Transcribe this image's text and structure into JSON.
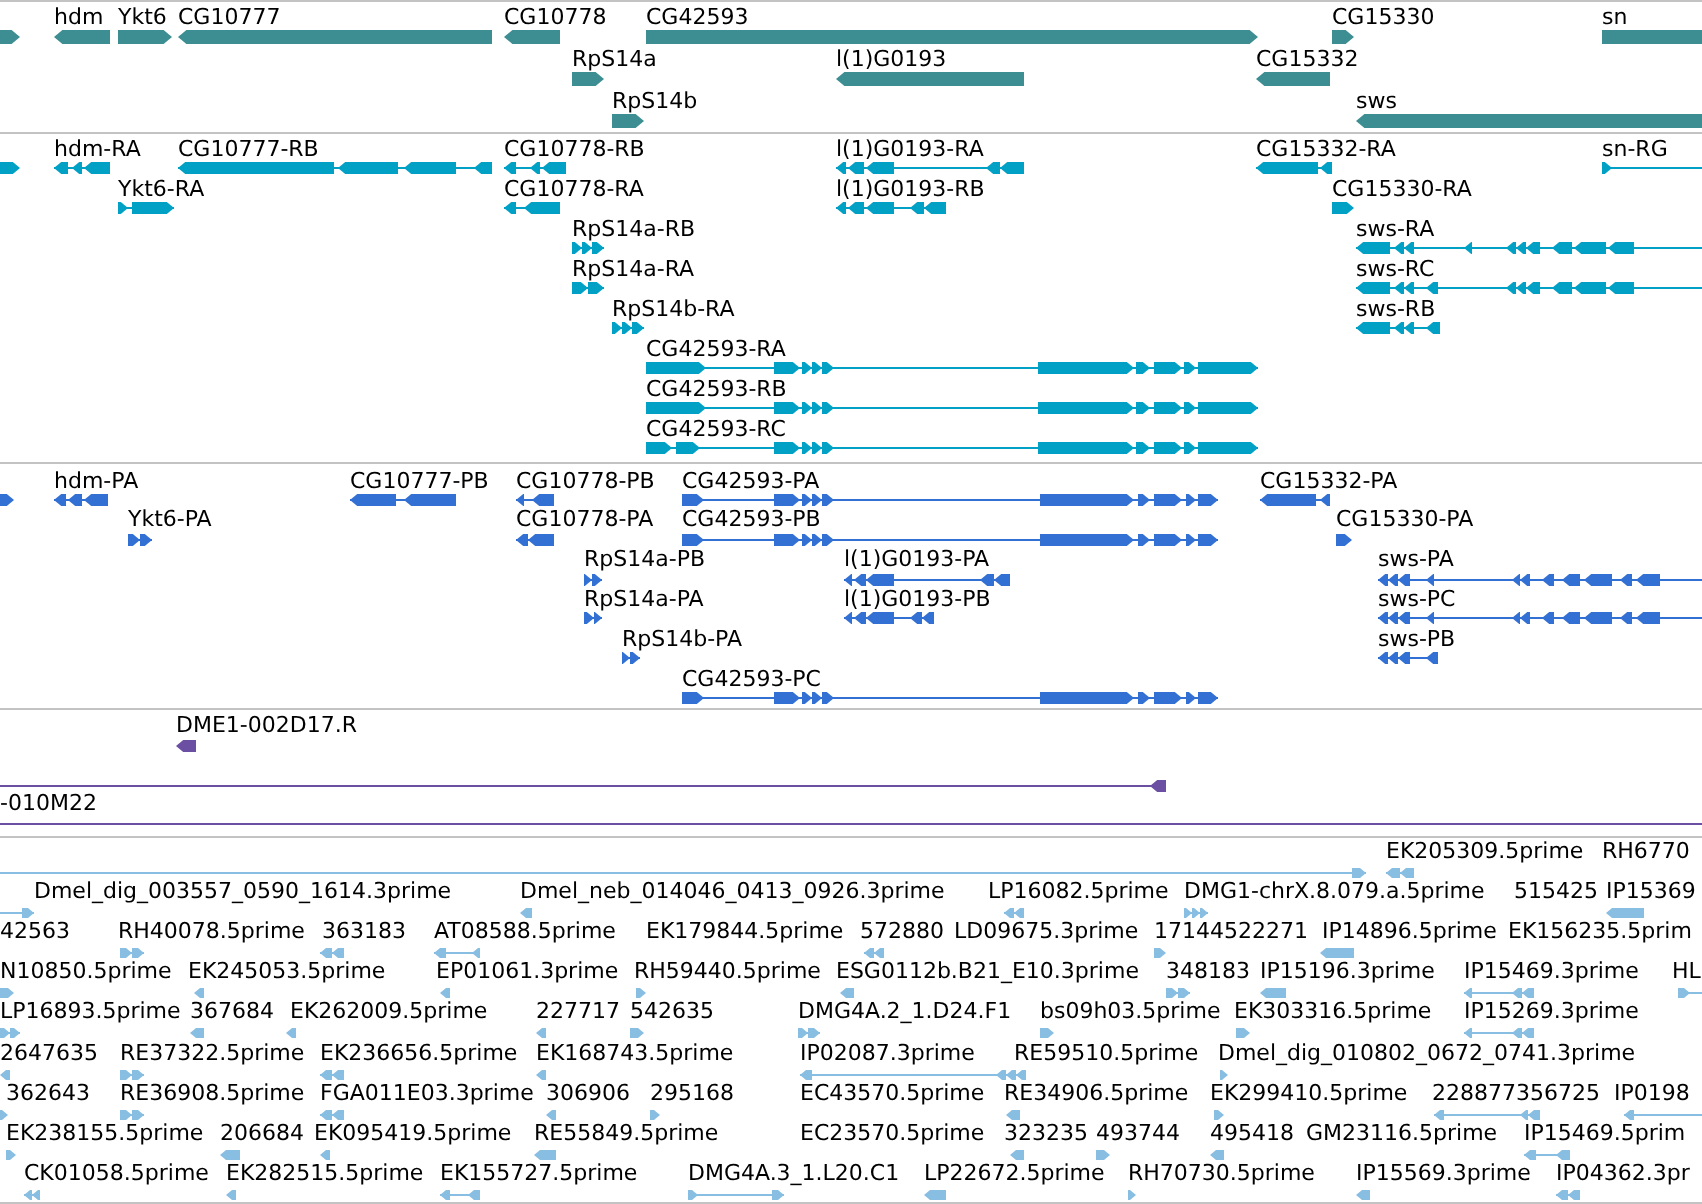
{
  "tracks": [
    {
      "kind": "gene",
      "rows": [
        {
          "features": [
            {
              "reverse": false
            },
            {
              "label": "hdm",
              "reverse": true
            },
            {
              "label": "Ykt6",
              "reverse": false
            },
            {
              "label": "CG10777",
              "reverse": true
            },
            {
              "label": "CG10778",
              "reverse": true
            },
            {
              "label": "CG42593",
              "reverse": false
            },
            {
              "label": "CG15330",
              "reverse": false
            },
            {
              "label": "sn"
            }
          ]
        },
        {
          "features": [
            {
              "label": "RpS14a",
              "reverse": false
            },
            {
              "label": "l(1)G0193",
              "reverse": true
            },
            {
              "label": "CG15332",
              "reverse": true
            }
          ]
        },
        {
          "features": [
            {
              "label": "RpS14b",
              "reverse": false
            },
            {
              "label": "sws",
              "reverse": true
            }
          ]
        }
      ]
    },
    {
      "kind": "transcript",
      "rows": [
        {
          "features": [
            {
              "reverse": false
            },
            {
              "label": "hdm-RA",
              "reverse": true
            },
            {
              "label": "CG10777-RB",
              "reverse": true
            },
            {
              "label": "CG10778-RB",
              "reverse": true
            },
            {
              "label": "l(1)G0193-RA",
              "reverse": true
            },
            {
              "label": "CG15332-RA",
              "reverse": true
            },
            {
              "label": "sn-RG",
              "reverse": false
            }
          ]
        },
        {
          "features": [
            {
              "label": "Ykt6-RA",
              "reverse": false
            },
            {
              "label": "CG10778-RA",
              "reverse": true
            },
            {
              "label": "l(1)G0193-RB",
              "reverse": true
            },
            {
              "label": "CG15330-RA",
              "reverse": false
            }
          ]
        },
        {
          "features": [
            {
              "label": "RpS14a-RB",
              "reverse": false
            },
            {
              "label": "sws-RA",
              "reverse": true
            }
          ]
        },
        {
          "features": [
            {
              "label": "RpS14a-RA",
              "reverse": false
            },
            {
              "label": "sws-RC",
              "reverse": true
            }
          ]
        },
        {
          "features": [
            {
              "label": "RpS14b-RA",
              "reverse": false
            },
            {
              "label": "sws-RB",
              "reverse": true
            }
          ]
        },
        {
          "features": [
            {
              "label": "CG42593-RA",
              "reverse": false
            }
          ]
        },
        {
          "features": [
            {
              "label": "CG42593-RB",
              "reverse": false
            }
          ]
        },
        {
          "features": [
            {
              "label": "CG42593-RC",
              "reverse": false
            }
          ]
        }
      ]
    },
    {
      "kind": "protein",
      "rows": [
        {
          "features": [
            {
              "reverse": false
            },
            {
              "label": "hdm-PA",
              "reverse": true
            },
            {
              "label": "CG10777-PB",
              "reverse": true
            },
            {
              "label": "CG10778-PB",
              "reverse": true
            },
            {
              "label": "CG42593-PA",
              "reverse": false
            },
            {
              "label": "CG15332-PA",
              "reverse": true
            }
          ]
        },
        {
          "features": [
            {
              "label": "Ykt6-PA",
              "reverse": false
            },
            {
              "label": "CG10778-PA",
              "reverse": true
            },
            {
              "label": "CG42593-PB",
              "reverse": false
            },
            {
              "label": "CG15330-PA",
              "reverse": false
            }
          ]
        },
        {
          "features": [
            {
              "label": "RpS14a-PB",
              "reverse": false
            },
            {
              "label": "l(1)G0193-PA",
              "reverse": true
            },
            {
              "label": "sws-PA",
              "reverse": true
            }
          ]
        },
        {
          "features": [
            {
              "label": "RpS14a-PA",
              "reverse": false
            },
            {
              "label": "l(1)G0193-PB",
              "reverse": true
            },
            {
              "label": "sws-PC",
              "reverse": true
            }
          ]
        },
        {
          "features": [
            {
              "label": "RpS14b-PA",
              "reverse": false
            },
            {
              "label": "sws-PB",
              "reverse": true
            }
          ]
        },
        {
          "features": [
            {
              "label": "CG42593-PC",
              "reverse": false
            }
          ]
        }
      ]
    },
    {
      "kind": "alignment",
      "rows": [
        {
          "features": [
            {
              "label": "DME1-002D17.R",
              "reverse": true
            }
          ]
        },
        {
          "features": [
            {
              "reverse": true
            }
          ]
        },
        {
          "features": [
            {
              "label": "-010M22"
            }
          ]
        }
      ]
    },
    {
      "kind": "est",
      "rows": [
        {
          "features": [
            {
              "reverse": false
            },
            {
              "label": "EK205309.5prime",
              "reverse": true
            },
            {
              "label": "RH6770"
            }
          ]
        },
        {
          "features": [
            {
              "reverse": false
            },
            {
              "label": "Dmel_dig_003557_0590_1614.3prime"
            },
            {
              "label": "Dmel_neb_014046_0413_0926.3prime",
              "reverse": true
            },
            {
              "label": "LP16082.5prime",
              "reverse": true
            },
            {
              "label": "DMG1-chrX.8.079.a.5prime",
              "reverse": false
            },
            {
              "label": "515425"
            },
            {
              "label": "IP15369",
              "reverse": true
            }
          ]
        },
        {
          "features": [
            {
              "label": "42563"
            },
            {
              "label": "RH40078.5prime",
              "reverse": false
            },
            {
              "label": "363183",
              "reverse": true
            },
            {
              "label": "AT08588.5prime",
              "reverse": true
            },
            {
              "label": "EK179844.5prime"
            },
            {
              "label": "572880",
              "reverse": true
            },
            {
              "label": "LD09675.3prime"
            },
            {
              "label": "17144522271",
              "reverse": false
            },
            {
              "label": "IP14896.5prime",
              "reverse": true
            },
            {
              "label": "EK156235.5prim"
            }
          ]
        },
        {
          "features": [
            {
              "label": "N10850.5prime",
              "reverse": false
            },
            {
              "label": "EK245053.5prime",
              "reverse": true
            },
            {
              "label": "EP01061.3prime",
              "reverse": true
            },
            {
              "label": "RH59440.5prime",
              "reverse": false
            },
            {
              "label": "ESG0112b.B21_E10.3prime",
              "reverse": true
            },
            {
              "label": "348183",
              "reverse": false
            },
            {
              "label": "IP15196.3prime",
              "reverse": true
            },
            {
              "label": "IP15469.3prime",
              "reverse": true
            },
            {
              "label": "HL",
              "reverse": false
            }
          ]
        },
        {
          "features": [
            {
              "label": "LP16893.5prime",
              "reverse": false
            },
            {
              "label": "367684",
              "reverse": true
            },
            {
              "label": "EK262009.5prime",
              "reverse": true
            },
            {
              "label": "227717",
              "reverse": true
            },
            {
              "label": "542635",
              "reverse": false
            },
            {
              "label": "DMG4A.2_1.D24.F1",
              "reverse": false
            },
            {
              "label": "bs09h03.5prime",
              "reverse": false
            },
            {
              "label": "EK303316.5prime",
              "reverse": false
            },
            {
              "label": "IP15269.3prime",
              "reverse": true
            }
          ]
        },
        {
          "features": [
            {
              "label": "2647635",
              "reverse": true
            },
            {
              "label": "RE37322.5prime",
              "reverse": false
            },
            {
              "label": "EK236656.5prime",
              "reverse": true
            },
            {
              "label": "EK168743.5prime",
              "reverse": true
            },
            {
              "label": "IP02087.3prime",
              "reverse": true
            },
            {
              "label": "RE59510.5prime"
            },
            {
              "label": "Dmel_dig_010802_0672_0741.3prime",
              "reverse": false
            }
          ]
        },
        {
          "features": [
            {
              "label": "362643",
              "reverse": false
            },
            {
              "label": "RE36908.5prime",
              "reverse": false
            },
            {
              "label": "FGA011E03.3prime",
              "reverse": true
            },
            {
              "label": "306906",
              "reverse": true
            },
            {
              "label": "295168",
              "reverse": false
            },
            {
              "label": "EC43570.5prime"
            },
            {
              "label": "RE34906.5prime",
              "reverse": true
            },
            {
              "label": "EK299410.5prime",
              "reverse": false
            },
            {
              "label": "228877356725",
              "reverse": true
            },
            {
              "label": "IP0198",
              "reverse": true
            }
          ]
        },
        {
          "features": [
            {
              "label": "EK238155.5prime",
              "reverse": false
            },
            {
              "label": "206684",
              "reverse": true
            },
            {
              "label": "EK095419.5prime",
              "reverse": true
            },
            {
              "label": "RE55849.5prime",
              "reverse": true
            },
            {
              "label": "EC23570.5prime"
            },
            {
              "label": "323235",
              "reverse": true
            },
            {
              "label": "493744",
              "reverse": false
            },
            {
              "label": "495418",
              "reverse": true
            },
            {
              "label": "GM23116.5prime"
            },
            {
              "label": "IP15469.5prim",
              "reverse": true
            }
          ]
        },
        {
          "features": [
            {
              "label": "CK01058.5prime",
              "reverse": true
            },
            {
              "label": "EK282515.5prime",
              "reverse": true
            },
            {
              "label": "EK155727.5prime",
              "reverse": true
            },
            {
              "label": "DMG4A.3_1.L20.C1",
              "reverse": false
            },
            {
              "label": "LP22672.5prime",
              "reverse": true
            },
            {
              "label": "RH70730.5prime",
              "reverse": false
            },
            {
              "label": "IP15569.3prime",
              "reverse": true
            },
            {
              "label": "IP04362.3pr",
              "reverse": true
            }
          ]
        }
      ]
    }
  ]
}
